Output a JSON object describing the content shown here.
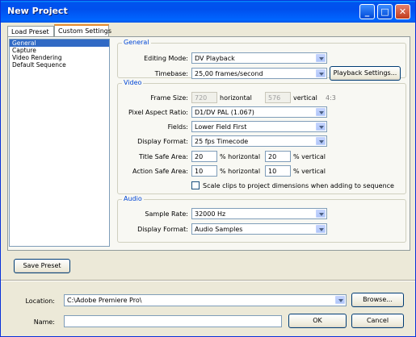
{
  "window": {
    "title": "New Project"
  },
  "title_buttons": {
    "minimize": "_",
    "maximize": "□",
    "close": "✕"
  },
  "tabs": [
    {
      "label": "Load Preset"
    },
    {
      "label": "Custom Settings"
    }
  ],
  "categories": [
    {
      "label": "General",
      "selected": true
    },
    {
      "label": "Capture"
    },
    {
      "label": "Video Rendering"
    },
    {
      "label": "Default Sequence"
    }
  ],
  "general": {
    "heading": "General",
    "editing_mode_label": "Editing Mode:",
    "editing_mode_value": "DV Playback",
    "timebase_label": "Timebase:",
    "timebase_value": "25,00 frames/second",
    "playback_settings_label": "Playback Settings..."
  },
  "video": {
    "heading": "Video",
    "frame_size_label": "Frame Size:",
    "frame_width": "720",
    "horizontal_label": "horizontal",
    "frame_height": "576",
    "vertical_label": "vertical",
    "aspect_ratio": "4:3",
    "pixel_aspect_label": "Pixel Aspect Ratio:",
    "pixel_aspect_value": "D1/DV PAL (1.067)",
    "fields_label": "Fields:",
    "fields_value": "Lower Field First",
    "display_format_label": "Display Format:",
    "display_format_value": "25 fps Timecode",
    "title_safe_label": "Title Safe Area:",
    "title_safe_h": "20",
    "title_safe_h_label": "% horizontal",
    "title_safe_v": "20",
    "title_safe_v_label": "% vertical",
    "action_safe_label": "Action Safe Area:",
    "action_safe_h": "10",
    "action_safe_h_label": "% horizontal",
    "action_safe_v": "10",
    "action_safe_v_label": "% vertical",
    "scale_clips_label": "Scale clips to project dimensions when adding to sequence"
  },
  "audio": {
    "heading": "Audio",
    "sample_rate_label": "Sample Rate:",
    "sample_rate_value": "32000 Hz",
    "display_format_label": "Display Format:",
    "display_format_value": "Audio Samples"
  },
  "save_preset_label": "Save Preset",
  "location": {
    "label": "Location:",
    "value": "C:\\Adobe Premiere Pro\\",
    "browse_label": "Browse..."
  },
  "name": {
    "label": "Name:",
    "value": ""
  },
  "ok_label": "OK",
  "cancel_label": "Cancel"
}
